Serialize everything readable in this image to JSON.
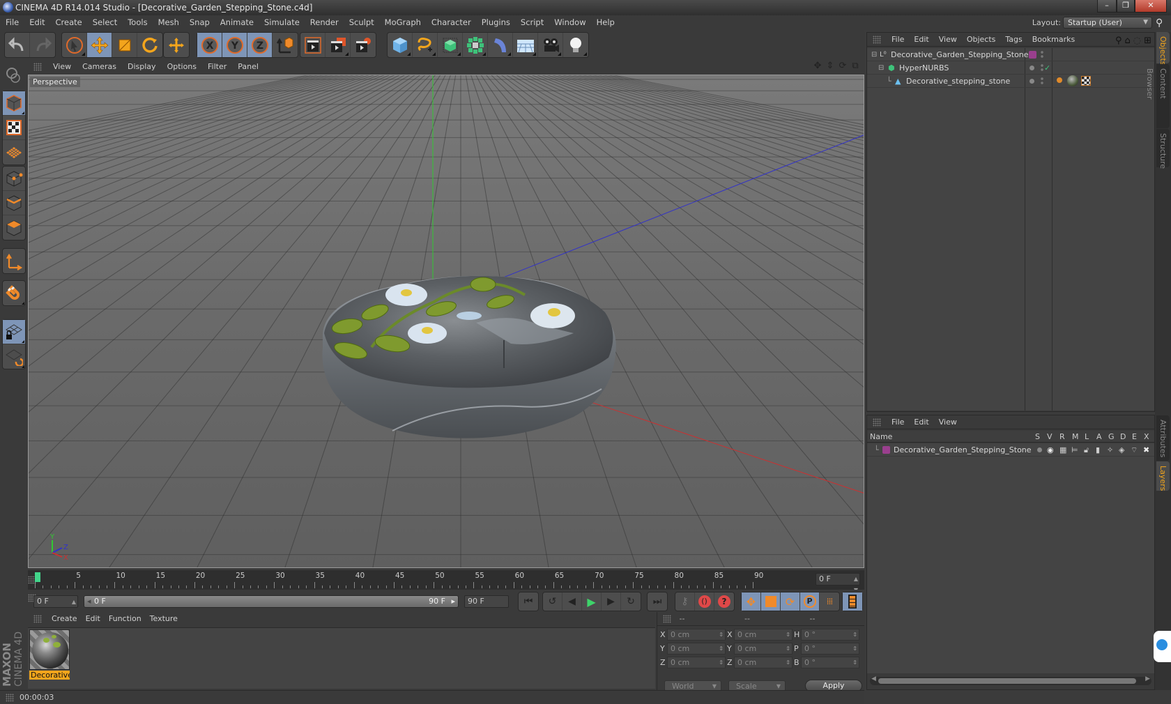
{
  "window": {
    "title": "CINEMA 4D R14.014 Studio - [Decorative_Garden_Stepping_Stone.c4d]",
    "controls": [
      "minimize",
      "restore",
      "close"
    ]
  },
  "menubar": {
    "items": [
      "File",
      "Edit",
      "Create",
      "Select",
      "Tools",
      "Mesh",
      "Snap",
      "Animate",
      "Simulate",
      "Render",
      "Sculpt",
      "MoGraph",
      "Character",
      "Plugins",
      "Script",
      "Window",
      "Help"
    ],
    "layout_label": "Layout:",
    "layout_value": "Startup (User)"
  },
  "toolbar": {
    "groups": [
      [
        "undo-icon",
        "redo-icon"
      ],
      [
        "live-selection-icon",
        "move-icon",
        "scale-icon",
        "rotate-icon"
      ],
      [
        "last-tool-icon"
      ],
      [
        "x-axis-icon",
        "y-axis-icon",
        "z-axis-icon",
        "coordinate-system-icon"
      ],
      [
        "render-view-icon",
        "render-picture-viewer-icon",
        "render-settings-icon"
      ],
      [
        "cube-icon",
        "spline-icon",
        "nurbs-icon",
        "mograph-cloner-icon",
        "deformer-icon",
        "floor-icon",
        "camera-icon",
        "light-icon"
      ]
    ]
  },
  "left_tools": [
    "make-editable-icon",
    "model-mode-icon",
    "texture-mode-icon",
    "workplane-mode-icon",
    "points-mode-icon",
    "edges-mode-icon",
    "polygons-mode-icon",
    "axis-mode-icon",
    "snap-icon",
    "locked-workplane-icon",
    "workplane-align-icon"
  ],
  "viewport": {
    "menu": [
      "View",
      "Cameras",
      "Display",
      "Options",
      "Filter",
      "Panel"
    ],
    "camera_label": "Perspective",
    "axis_labels": {
      "x": "X",
      "y": "Y",
      "z": "Z"
    }
  },
  "timeline": {
    "ticks": [
      "0",
      "5",
      "10",
      "15",
      "20",
      "25",
      "30",
      "35",
      "40",
      "45",
      "50",
      "55",
      "60",
      "65",
      "70",
      "75",
      "80",
      "85",
      "90"
    ],
    "current_frame": "0 F",
    "start_field": "0 F",
    "range_start": "0 F",
    "range_end": "90 F",
    "end_field": "90 F",
    "playhead_frame": 0
  },
  "transport": {
    "playback": [
      "go-to-start-icon",
      "previous-key-icon",
      "step-back-icon",
      "play-icon",
      "step-forward-icon",
      "next-key-icon",
      "go-to-end-icon"
    ],
    "record": [
      "autokey-icon",
      "record-icon",
      "keyframe-selection-icon"
    ],
    "key_modes": [
      "key-position-icon",
      "key-scale-icon",
      "key-rotation-icon",
      "key-parameter-icon",
      "key-point-level-icon"
    ],
    "timeline_button": "timeline-icon"
  },
  "material_manager": {
    "menu": [
      "Create",
      "Edit",
      "Function",
      "Texture"
    ],
    "materials": [
      {
        "name": "Decorative"
      }
    ]
  },
  "coordinates": {
    "headers": [
      "--",
      "--",
      "--"
    ],
    "rows": [
      {
        "l1": "X",
        "v1": "0 cm",
        "l2": "X",
        "v2": "0 cm",
        "l3": "H",
        "v3": "0 °"
      },
      {
        "l1": "Y",
        "v1": "0 cm",
        "l2": "Y",
        "v2": "0 cm",
        "l3": "P",
        "v3": "0 °"
      },
      {
        "l1": "Z",
        "v1": "0 cm",
        "l2": "Z",
        "v2": "0 cm",
        "l3": "B",
        "v3": "0 °"
      }
    ],
    "space_dropdown": "World",
    "mode_dropdown": "Scale",
    "apply_label": "Apply"
  },
  "status": {
    "time": "00:00:03"
  },
  "object_manager": {
    "menu": [
      "File",
      "Edit",
      "View",
      "Objects",
      "Tags",
      "Bookmarks"
    ],
    "objects": [
      {
        "name": "Decorative_Garden_Stepping_Stone",
        "type": "null",
        "indent": 0,
        "layer_color": "#9a3f8e"
      },
      {
        "name": "HyperNURBS",
        "type": "hypernurbs",
        "indent": 1,
        "enabled_check": "✓"
      },
      {
        "name": "Decorative_stepping_stone",
        "type": "polygon",
        "indent": 2,
        "tags": [
          "phong-tag",
          "material-tag",
          "texture-tag"
        ]
      }
    ]
  },
  "layer_manager": {
    "menu": [
      "File",
      "Edit",
      "View"
    ],
    "columns": [
      "Name",
      "S",
      "V",
      "R",
      "M",
      "L",
      "A",
      "G",
      "D",
      "E",
      "X"
    ],
    "layers": [
      {
        "name": "Decorative_Garden_Stepping_Stone",
        "color": "#9a3f8e"
      }
    ]
  },
  "right_tabs": {
    "top": [
      {
        "label": "Objects",
        "active": true
      },
      {
        "label": "Content Browser",
        "active": false
      },
      {
        "label": "Structure",
        "active": false
      }
    ],
    "bottom": [
      {
        "label": "Attributes",
        "active": false
      },
      {
        "label": "Layers",
        "active": true
      }
    ]
  },
  "colors": {
    "accent_orange": "#f3a51c",
    "selected_blue": "#7e95b7",
    "layer_purple": "#9a3f8e",
    "axis_x": "#c83232",
    "axis_y": "#32c832",
    "axis_z": "#3232c8"
  }
}
